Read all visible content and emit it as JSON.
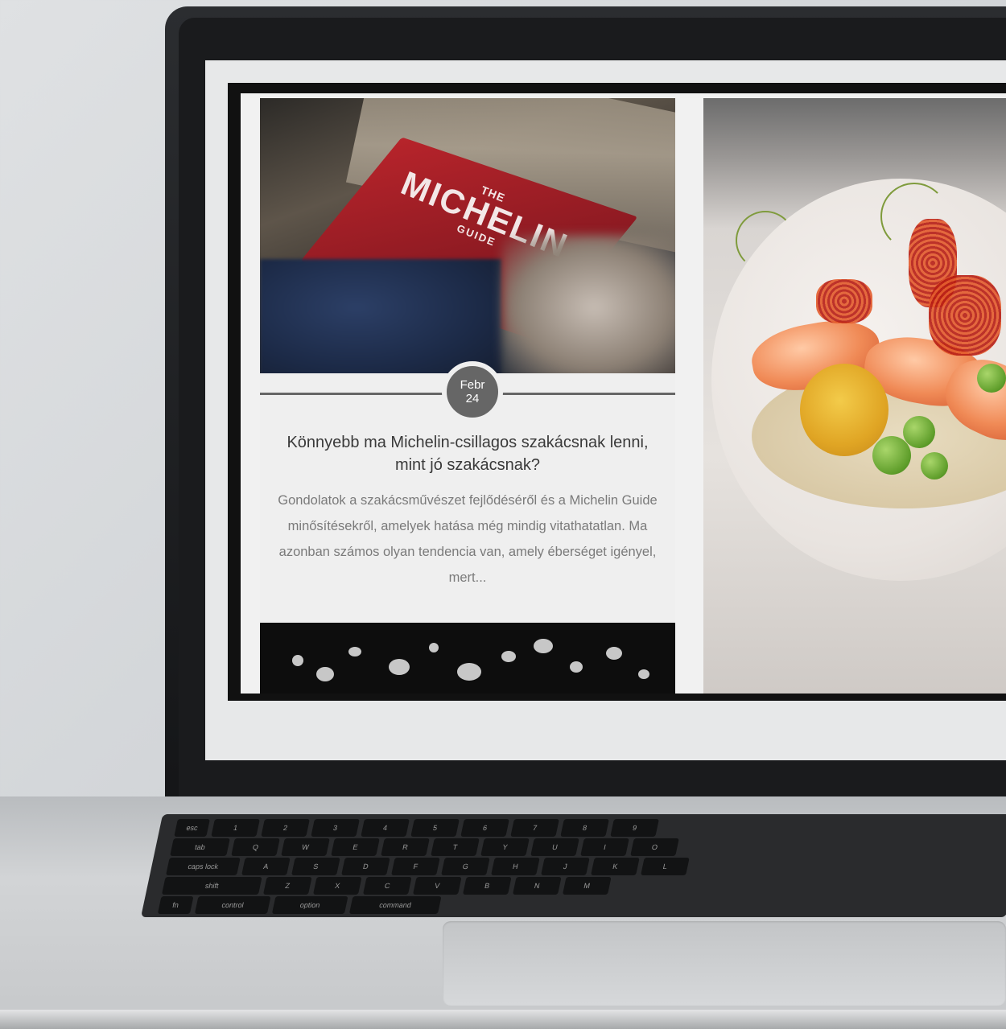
{
  "article": {
    "date_month": "Febr",
    "date_day": "24",
    "title": "Könnyebb ma Michelin-csillagos szakácsnak lenni, mint jó szakácsnak?",
    "excerpt": "Gondolatok a szakácsművészet fejlődéséről és a Michelin Guide minősítésekről, amelyek hatása még mindig vitathatatlan. Ma azonban számos olyan tendencia van, amely éberséget igényel, mert..."
  },
  "book_cover": {
    "line1": "THE",
    "line2": "MICHELIN",
    "line3": "GUIDE"
  },
  "keyboard": {
    "row1": [
      "esc",
      "1",
      "2",
      "3",
      "4",
      "5",
      "6",
      "7",
      "8",
      "9"
    ],
    "row2": [
      "tab",
      "Q",
      "W",
      "E",
      "R",
      "T",
      "Y",
      "U",
      "I",
      "O"
    ],
    "row3": [
      "caps lock",
      "A",
      "S",
      "D",
      "F",
      "G",
      "H",
      "J",
      "K",
      "L"
    ],
    "row4": [
      "shift",
      "Z",
      "X",
      "C",
      "V",
      "B",
      "N",
      "M"
    ],
    "row5": [
      "fn",
      "control",
      "option",
      "command"
    ]
  }
}
